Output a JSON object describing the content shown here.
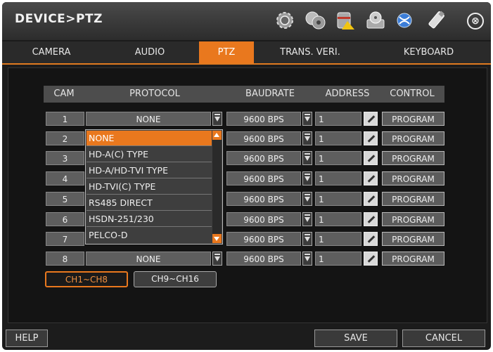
{
  "title": "DEVICE>PTZ",
  "toolbar_icons": [
    "gear-icon",
    "camera-reel-icon",
    "database-icon",
    "disc-drive-icon",
    "network-icon",
    "usb-icon"
  ],
  "close_icon": "⊗",
  "tabs": [
    {
      "label": "CAMERA",
      "active": false
    },
    {
      "label": "AUDIO",
      "active": false
    },
    {
      "label": "PTZ",
      "active": true
    },
    {
      "label": "TRANS. VERI.",
      "active": false
    },
    {
      "label": "KEYBOARD",
      "active": false
    }
  ],
  "columns": {
    "cam": "CAM",
    "protocol": "PROTOCOL",
    "baudrate": "BAUDRATE",
    "address": "ADDRESS",
    "control": "CONTROL"
  },
  "rows": [
    {
      "cam": "1",
      "protocol": "NONE",
      "baudrate": "9600 BPS",
      "address": "1",
      "control": "PROGRAM"
    },
    {
      "cam": "2",
      "protocol": "",
      "baudrate": "9600 BPS",
      "address": "1",
      "control": "PROGRAM"
    },
    {
      "cam": "3",
      "protocol": "",
      "baudrate": "9600 BPS",
      "address": "1",
      "control": "PROGRAM"
    },
    {
      "cam": "4",
      "protocol": "",
      "baudrate": "9600 BPS",
      "address": "1",
      "control": "PROGRAM"
    },
    {
      "cam": "5",
      "protocol": "",
      "baudrate": "9600 BPS",
      "address": "1",
      "control": "PROGRAM"
    },
    {
      "cam": "6",
      "protocol": "",
      "baudrate": "9600 BPS",
      "address": "1",
      "control": "PROGRAM"
    },
    {
      "cam": "7",
      "protocol": "",
      "baudrate": "9600 BPS",
      "address": "1",
      "control": "PROGRAM"
    },
    {
      "cam": "8",
      "protocol": "NONE",
      "baudrate": "9600 BPS",
      "address": "1",
      "control": "PROGRAM"
    }
  ],
  "dropdown": {
    "options": [
      "NONE",
      "HD-A(C) TYPE",
      "HD-A/HD-TVI TYPE",
      "HD-TVI(C) TYPE",
      "RS485 DIRECT",
      "HSDN-251/230",
      "PELCO-D"
    ],
    "selected": "NONE"
  },
  "pages": [
    {
      "label": "CH1~CH8",
      "active": true
    },
    {
      "label": "CH9~CH16",
      "active": false
    }
  ],
  "footer": {
    "help": "HELP",
    "save": "SAVE",
    "cancel": "CANCEL"
  },
  "colors": {
    "accent": "#e9781e",
    "background": "#1c1c1c"
  }
}
